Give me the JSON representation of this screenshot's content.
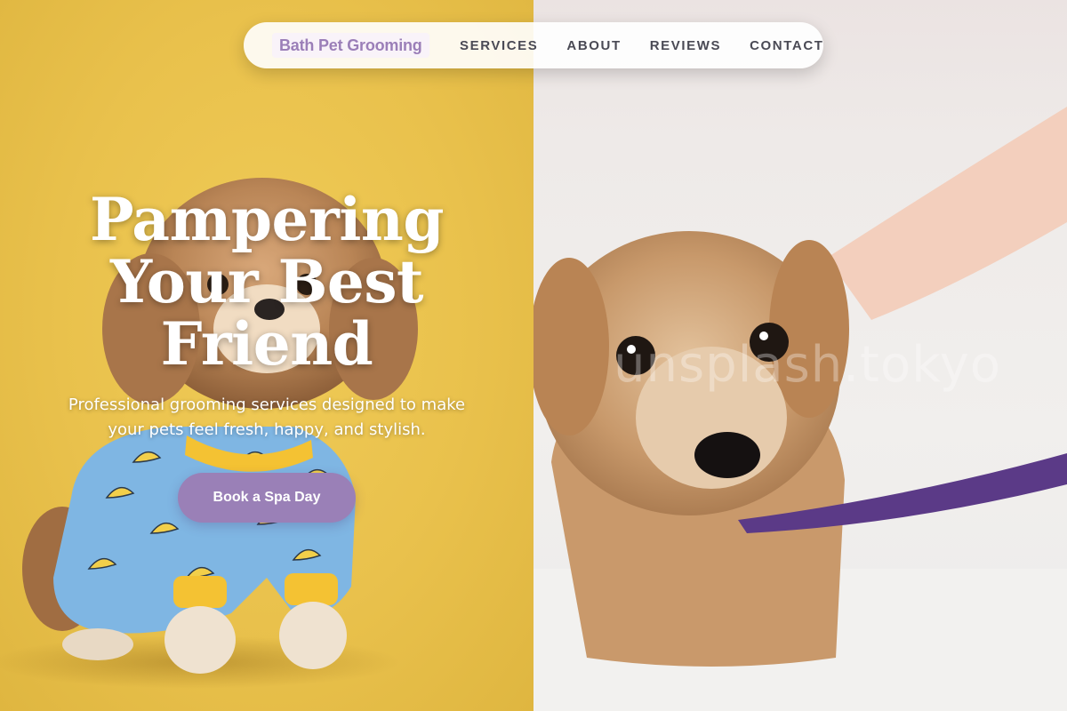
{
  "nav": {
    "brand": "Bath Pet Grooming",
    "links": [
      "SERVICES",
      "ABOUT",
      "REVIEWS",
      "CONTACT"
    ]
  },
  "hero": {
    "title_lines": [
      "Pampering",
      "Your Best",
      "Friend"
    ],
    "subtitle": "Professional grooming services designed to make your pets feel fresh, happy, and stylish.",
    "cta_label": "Book a Spa Day"
  },
  "watermark": "unsplash.tokyo",
  "colors": {
    "accent": "#9a80b7",
    "brand_text": "#9b7fb8",
    "nav_text": "#4a4a55",
    "left_background": "#e9c14c",
    "leash": "#5b3a87"
  },
  "images": {
    "left": "dog-in-banana-pajamas-photo",
    "right": "wet-dog-in-bath-photo"
  }
}
